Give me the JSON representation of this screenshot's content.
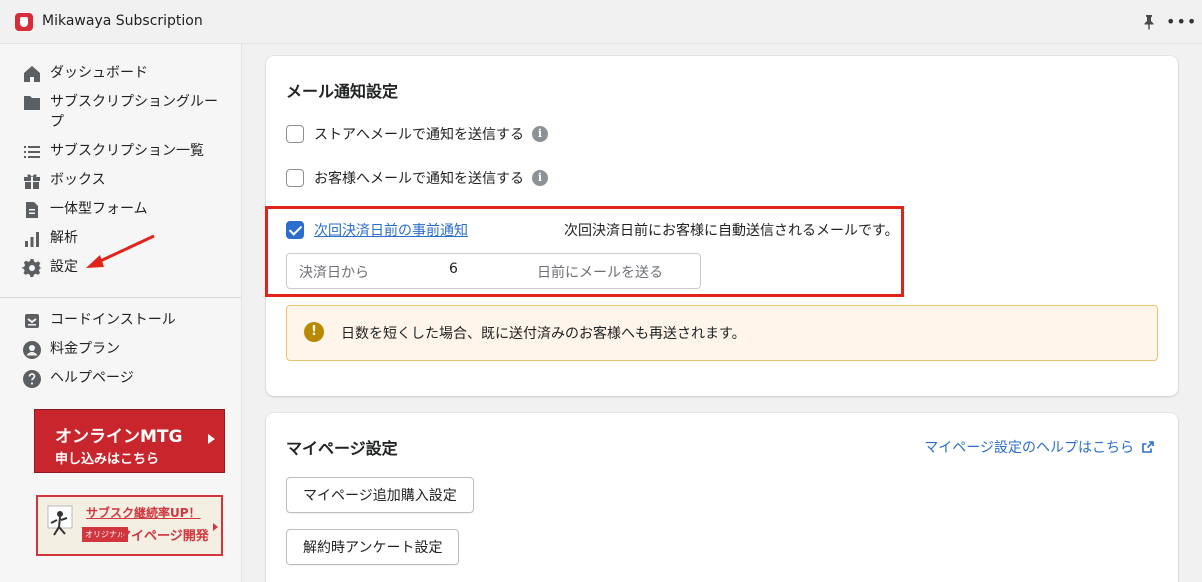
{
  "app": {
    "title": "Mikawaya Subscription"
  },
  "sidebar": {
    "items": [
      {
        "label": "ダッシュボード",
        "icon": "home-icon"
      },
      {
        "label": "サブスクリプショングループ",
        "icon": "folder-icon"
      },
      {
        "label": "サブスクリプション一覧",
        "icon": "list-icon"
      },
      {
        "label": "ボックス",
        "icon": "gift-icon"
      },
      {
        "label": "一体型フォーム",
        "icon": "document-icon"
      },
      {
        "label": "解析",
        "icon": "analytics-icon"
      },
      {
        "label": "設定",
        "icon": "gear-icon"
      }
    ],
    "secondary_items": [
      {
        "label": "コードインストール",
        "icon": "code-install-icon"
      },
      {
        "label": "料金プラン",
        "icon": "person-icon"
      },
      {
        "label": "ヘルプページ",
        "icon": "help-icon"
      }
    ],
    "banner_mtg": {
      "line1": "オンラインMTG",
      "line2": "申し込みはこちら"
    },
    "banner_mypage": {
      "line1": "サブスク継続率UP！",
      "tag": "オリジナル",
      "line2": "マイページ開発"
    }
  },
  "email_settings": {
    "title": "メール通知設定",
    "store_email": {
      "label": "ストアへメールで通知を送信する",
      "checked": false
    },
    "customer_email": {
      "label": "お客様へメールで通知を送信する",
      "checked": false
    },
    "pre_notice": {
      "label": "次回決済日前の事前通知",
      "checked": true,
      "description": "次回決済日前にお客様に自動送信されるメールです。",
      "prefix": "決済日から",
      "days": "6",
      "suffix": "日前にメールを送る"
    },
    "warning": "日数を短くした場合、既に送付済みのお客様へも再送されます。"
  },
  "mypage_settings": {
    "title": "マイページ設定",
    "help_link": "マイページ設定のヘルプはこちら",
    "buttons": [
      "マイページ追加購入設定",
      "解約時アンケート設定"
    ]
  },
  "colors": {
    "accent": "#2c6ecb",
    "highlight": "#e2231a",
    "brand_red": "#c8252c",
    "warning_bg": "#fff5ea"
  }
}
